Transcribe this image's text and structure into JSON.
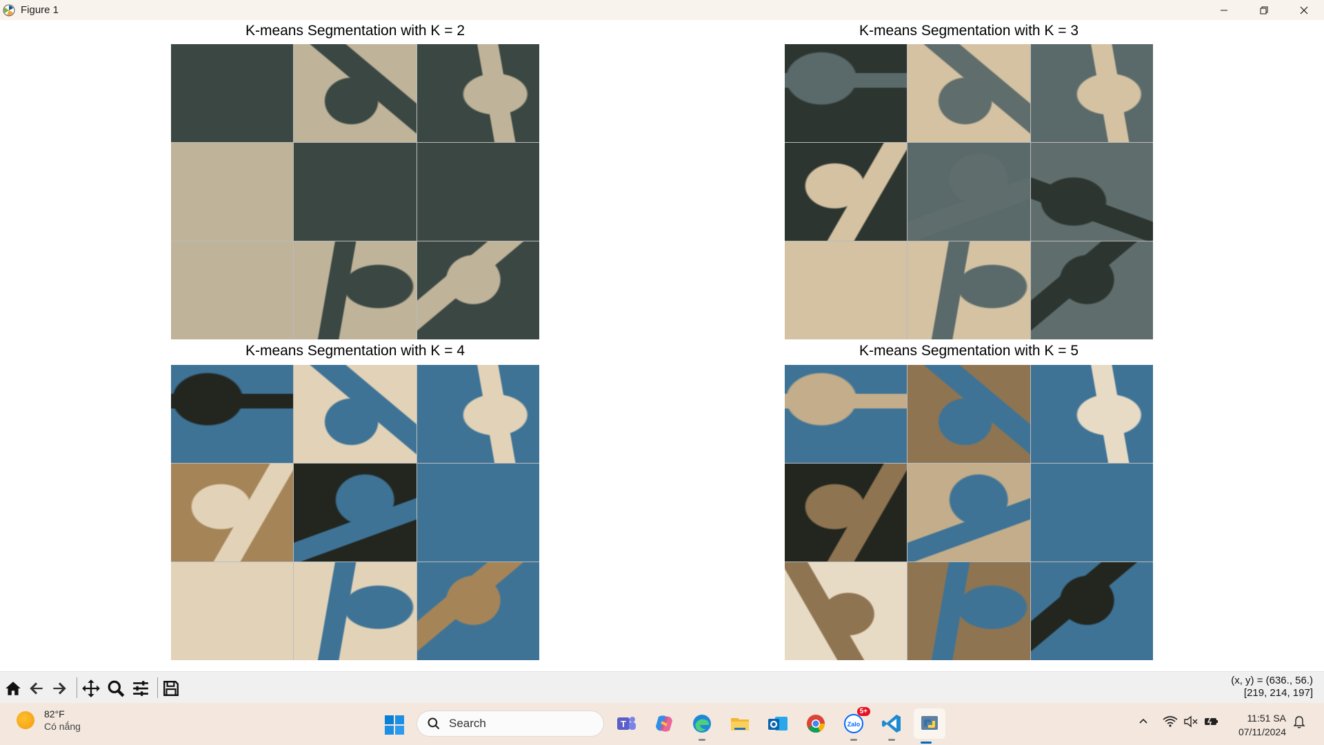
{
  "window": {
    "title": "Figure 1",
    "minimize_icon": "minimize-icon",
    "restore_icon": "restore-icon",
    "close_icon": "close-icon"
  },
  "figure": {
    "subplots": [
      {
        "title": "K-means Segmentation with K = 2",
        "palette": [
          "#3a4743",
          "#bfb399",
          "#3a4743",
          "#bfb399",
          "#3a4743",
          "#3a4743",
          "#bfb399",
          "#bfb399",
          "#3a4743"
        ]
      },
      {
        "title": "K-means Segmentation with K = 3",
        "palette": [
          "#2c3530",
          "#d4c2a2",
          "#5a6a6a",
          "#2c3530",
          "#5a6a6a",
          "#5f6e6c",
          "#d4c2a2",
          "#d4c2a2",
          "#5f6e6c"
        ]
      },
      {
        "title": "K-means Segmentation with K = 4",
        "palette": [
          "#3e7396",
          "#e2d3b8",
          "#3e7396",
          "#a58458",
          "#22261f",
          "#3e7396",
          "#e2d3b8",
          "#e2d3b8",
          "#3e7396"
        ]
      },
      {
        "title": "K-means Segmentation with K = 5",
        "palette": [
          "#3e7396",
          "#8e7451",
          "#3e7396",
          "#22261f",
          "#c3ad8a",
          "#3e7396",
          "#e8dbc5",
          "#8e7451",
          "#3e7396"
        ]
      }
    ]
  },
  "toolbar": {
    "tools": [
      "home-icon",
      "back-icon",
      "forward-icon",
      "pan-icon",
      "zoom-icon",
      "configure-subplots-icon",
      "save-icon"
    ],
    "coords_line1": "(x, y) = (636., 56.)",
    "coords_line2": "[219, 214, 197]"
  },
  "taskbar": {
    "weather_temp": "82°F",
    "weather_condition": "Có nắng",
    "search_label": "Search",
    "apps": [
      "windows-start-icon",
      "teams-icon",
      "copilot-icon",
      "edge-icon",
      "file-explorer-icon",
      "outlook-icon",
      "chrome-icon",
      "zalo-icon",
      "vscode-icon",
      "python-icon"
    ],
    "zalo_badge": "5+",
    "time": "11:51 SA",
    "date": "07/11/2024"
  }
}
